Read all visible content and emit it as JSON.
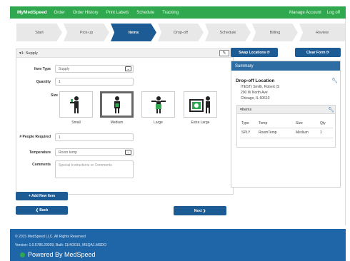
{
  "nav": {
    "brand": "MyMedSpeed",
    "links": [
      "Order",
      "Order History",
      "Print Labels",
      "Schedule",
      "Tracking"
    ],
    "right": [
      "Manage Account",
      "Log off"
    ]
  },
  "wizard": {
    "steps": [
      "Start",
      "Pick-up",
      "Items",
      "Drop-off",
      "Schedule",
      "Billing",
      "Review"
    ],
    "active_index": 2
  },
  "item": {
    "header": "▾1: Supply",
    "edit_icon": "pencil-icon",
    "labels": {
      "item_type": "Item Type",
      "quantity": "Quantity",
      "size": "Size",
      "num_people": "# People Required",
      "temperature": "Temperature",
      "comments": "Comments"
    },
    "values": {
      "item_type": "Supply",
      "quantity": "1",
      "num_people": "1",
      "temperature": "Room temp",
      "comments_placeholder": "Special Instructions or Comments"
    },
    "sizes": [
      "Small",
      "Medium",
      "Large",
      "Extra Large"
    ],
    "selected_size": "Medium"
  },
  "buttons": {
    "add_item": "+ Add New Item",
    "back": "❮ Back",
    "next": "Next ❯",
    "swap_locations": "Swap Locations ⟳",
    "clear_form": "Clear Form ⟳"
  },
  "summary": {
    "title": "Summary",
    "dropoff_title": "Drop-off Location",
    "address": [
      "ITEST) Smith, Robert (S",
      "200 W North Ave",
      "Chicago, IL 60610"
    ],
    "items_header": "▾Items",
    "columns": [
      "Type",
      "Temp",
      "Size",
      "Qty"
    ],
    "row": [
      "SPLY",
      "RoomTemp",
      "Medium",
      "1"
    ]
  },
  "footer": {
    "copyright": "© 2015 MedSpeed LLC. All Rights Reserved",
    "version": "Version: 1.0.5786.29209, Built: 11/4/2015, MSQA1.MSDO",
    "powered": "Powered By MedSpeed"
  },
  "colors": {
    "nav_green": "#2fa84f",
    "primary_blue": "#1d5b95",
    "footer_blue": "#1f66a8"
  }
}
